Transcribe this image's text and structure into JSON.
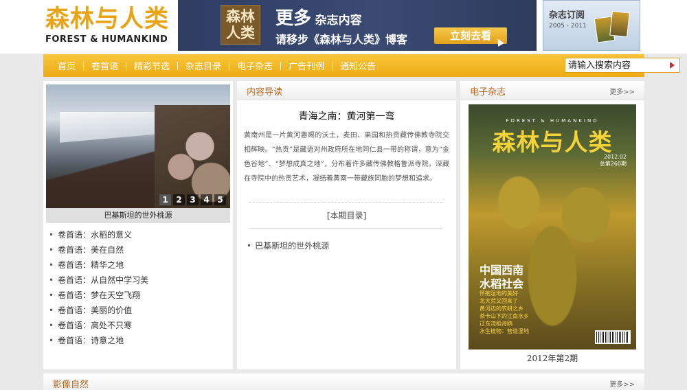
{
  "header": {
    "logo_cn": "森林与人类",
    "logo_en": "FOREST & HUMANKIND",
    "banner": {
      "mark_line1": "森林",
      "mark_line2": "人类",
      "title_big": "更多",
      "title_small": "杂志内容",
      "subtitle": "请移步《森林与人类》博客",
      "button": "立刻去看"
    },
    "subscribe": {
      "title": "杂志订阅",
      "years": "2005 - 2011"
    }
  },
  "nav": {
    "items": [
      "首页",
      "卷首语",
      "精彩节选",
      "杂志目录",
      "电子杂志",
      "广告刊例",
      "通知公告"
    ],
    "search_placeholder": "请输入搜索内容"
  },
  "left": {
    "slide_caption": "巴基斯坦的世外桃源",
    "pager": [
      "1",
      "2",
      "3",
      "4",
      "5"
    ],
    "active_page": 1,
    "list": [
      "卷首语：水稻的意义",
      "卷首语：美在自然",
      "卷首语：精华之地",
      "卷首语：从自然中学习美",
      "卷首语：梦在天空飞翔",
      "卷首语：美丽的价值",
      "卷首语：高处不只寒",
      "卷首语：诗意之地"
    ]
  },
  "middle": {
    "panel_title": "内容导读",
    "article_title": "青海之南：黄河第一弯",
    "article_body": "黄南州是一片黄河惠赐的沃土，麦田、果园和热贡藏传佛教寺院交相辉映。“热贡”是藏语对州政府所在地同仁县一带的称谓，意为“金色谷地”、“梦想成真之地”，分布着许多藏传佛教格鲁派寺院。深藏在寺院中的热贡艺术，凝结着黄南一带藏族同胞的梦想和追求。",
    "toc_title": "[本期目录]",
    "toc_items": [
      "巴基斯坦的世外桃源"
    ]
  },
  "right": {
    "panel_title": "电子杂志",
    "more": "更多>>",
    "cover": {
      "en_title": "FOREST & HUMANKIND",
      "logo": "森林与人类",
      "issue_line1": "2012.02",
      "issue_line2": "总第260期",
      "headline1": "中国西南",
      "headline2": "水稻社会",
      "lines": [
        "怀抱湿地的美好",
        "北大荒又回来了",
        "黄河边的农耕之乡",
        "茶卡山下的江南水乡",
        "辽东湾稻海鸥",
        "水生植物：营造湿地"
      ]
    },
    "caption": "2012年第2期"
  },
  "bottom": {
    "panel_title": "影像自然",
    "more": "更多>>"
  },
  "colors": {
    "accent": "#eeab14",
    "title_brown": "#b7651a",
    "logo_gold": "#e8a317"
  }
}
